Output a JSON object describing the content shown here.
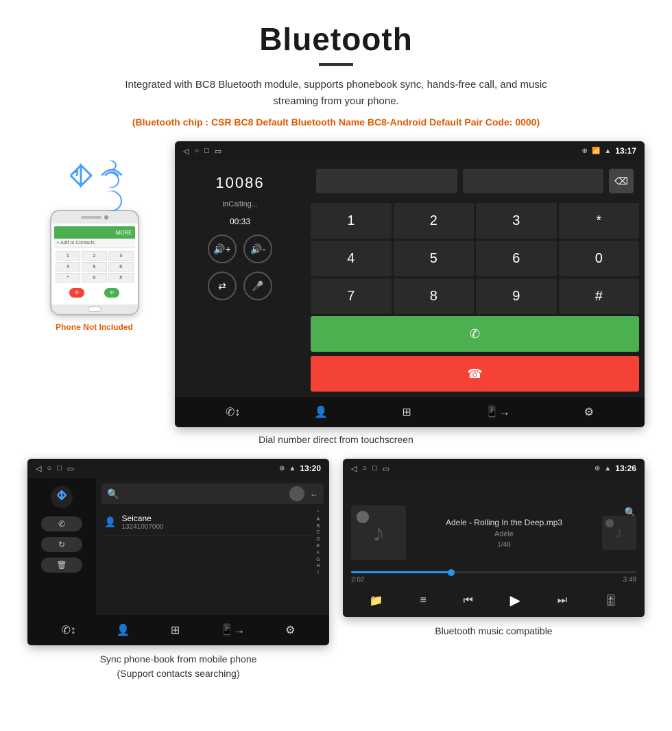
{
  "title": "Bluetooth",
  "divider": "—",
  "description": "Integrated with BC8 Bluetooth module, supports phonebook sync, hands-free call, and music streaming from your phone.",
  "specs": "(Bluetooth chip : CSR BC8    Default Bluetooth Name BC8-Android    Default Pair Code: 0000)",
  "dial_screen": {
    "time": "13:17",
    "number": "10086",
    "status": "InCalling...",
    "timer": "00:33",
    "keys": [
      "1",
      "2",
      "3",
      "*",
      "4",
      "5",
      "6",
      "0",
      "7",
      "8",
      "9",
      "#"
    ],
    "call_answer": "☎",
    "call_end": "☎"
  },
  "dial_caption": "Dial number direct from touchscreen",
  "phonebook_screen": {
    "time": "13:20",
    "search_placeholder": "",
    "contact_name": "Seicane",
    "contact_number": "13241007000",
    "alpha": [
      "*",
      "A",
      "B",
      "C",
      "D",
      "E",
      "F",
      "G",
      "H",
      "I"
    ]
  },
  "phonebook_caption": "Sync phone-book from mobile phone\n(Support contacts searching)",
  "music_screen": {
    "time": "13:26",
    "song_title": "Adele - Rolling In the Deep.mp3",
    "artist": "Adele",
    "count": "1/48",
    "time_current": "2:02",
    "time_total": "3:49",
    "progress_percent": 35
  },
  "music_caption": "Bluetooth music compatible",
  "phone_not_included": "Phone Not Included",
  "icons": {
    "bluetooth": "✦",
    "back": "◁",
    "home": "○",
    "square": "□",
    "phone": "✆",
    "person": "👤",
    "grid": "⊞",
    "phone_transfer": "📱",
    "settings": "⚙",
    "vol_up": "🔊",
    "vol_down": "🔉",
    "transfer": "⇄",
    "mic": "🎤",
    "delete": "⌫",
    "search": "🔍",
    "folder": "📁",
    "list": "≡",
    "prev": "⏮",
    "play": "▶",
    "next": "⏭",
    "eq": "🎚",
    "shuffle": "⇄"
  }
}
